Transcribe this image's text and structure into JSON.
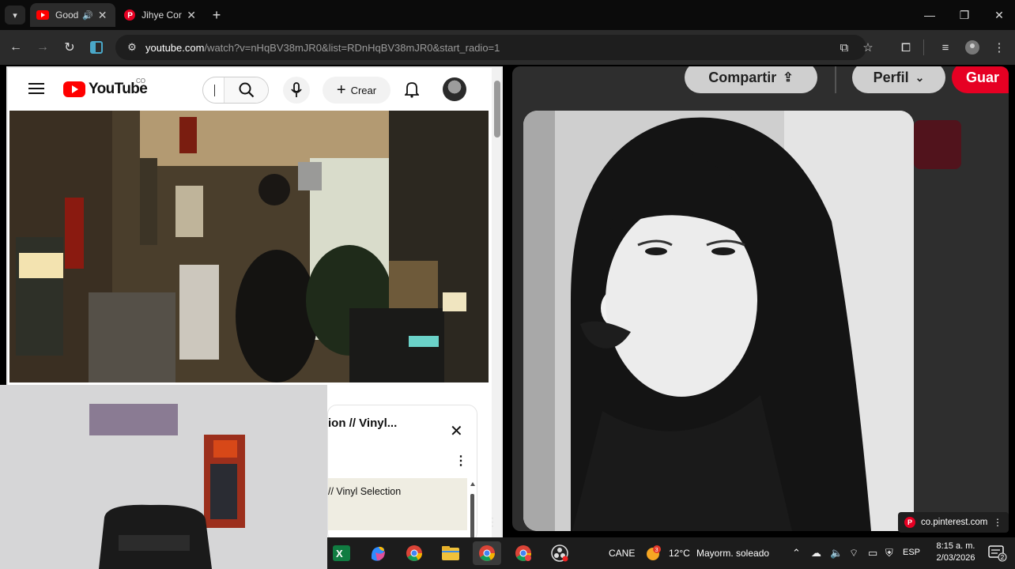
{
  "browser": {
    "tabs": [
      {
        "title": "Good",
        "favicon": "youtube-favicon",
        "active": true
      },
      {
        "title": "Jihye Cor",
        "favicon": "pinterest-favicon",
        "active": false
      }
    ],
    "new_tab_label": "+",
    "url_host": "youtube.com",
    "url_path": "/watch?v=nHqBV38mJR0&list=RDnHqBV38mJR0&start_radio=1"
  },
  "youtube": {
    "logo_text": "YouTube",
    "country_code": "CO",
    "create_label": "Crear",
    "panel_title": "ion // Vinyl...",
    "panel_item_title": "// Vinyl Selection"
  },
  "pinterest": {
    "share_label": "Compartir",
    "profile_label": "Perfil",
    "save_label": "Guar",
    "status_url": "co.pinterest.com"
  },
  "taskbar": {
    "user_label": "CANE",
    "weather_temp": "12°C",
    "weather_desc": "Mayorm. soleado",
    "weather_badge": "3",
    "language": "ESP",
    "time": "8:15 a. m.",
    "date": "2/03/2026",
    "notification_count": "2"
  },
  "colors": {
    "youtube_red": "#ff0000",
    "pinterest_red": "#e60023",
    "chrome_dark": "#2b2b2b"
  }
}
